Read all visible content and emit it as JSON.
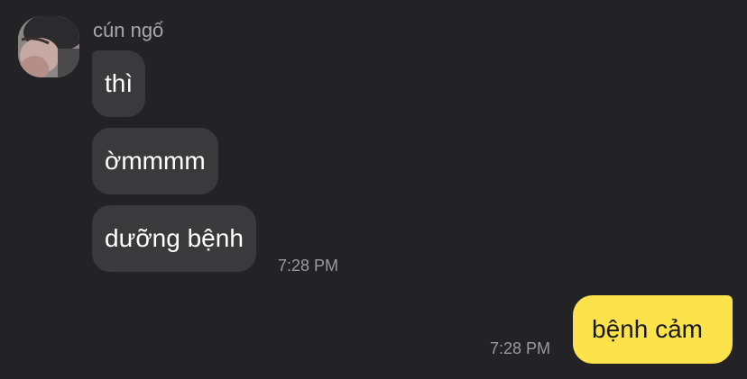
{
  "contact": {
    "name": "cún ngố",
    "avatar_icon": "user-avatar-photo"
  },
  "messages": [
    {
      "direction": "incoming",
      "text": "thì"
    },
    {
      "direction": "incoming",
      "text": "ờmmmm"
    },
    {
      "direction": "incoming",
      "text": "dưỡng bệnh",
      "time": "7:28 PM"
    },
    {
      "direction": "outgoing",
      "text": "bệnh cảm",
      "time": "7:28 PM"
    }
  ],
  "colors": {
    "background": "#232325",
    "incoming_bubble": "#3a3a3c",
    "outgoing_bubble": "#fde34b",
    "timestamp": "#9b9b9e"
  }
}
